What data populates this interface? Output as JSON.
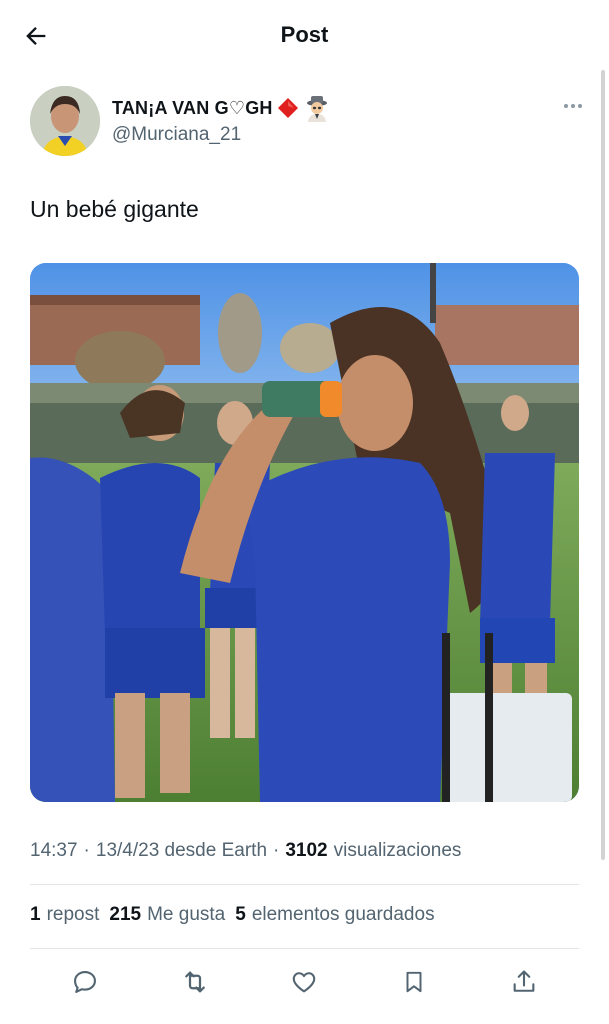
{
  "header": {
    "title": "Post",
    "back_icon": "arrow-left-icon"
  },
  "author": {
    "display_name": "TAN¡A VAN G♡GH",
    "handle": "@Murciana_21",
    "emojis": [
      "diamond-emoji",
      "spy-emoji"
    ]
  },
  "tweet": {
    "text": "Un bebé gigante"
  },
  "meta": {
    "time": "14:37",
    "sep1": "·",
    "date": "13/4/23 desde Earth",
    "sep2": "·",
    "views_count": "3102",
    "views_label": "visualizaciones"
  },
  "stats": {
    "reposts_count": "1",
    "reposts_label": "repost",
    "likes_count": "215",
    "likes_label": "Me gusta",
    "bookmarks_count": "5",
    "bookmarks_label": "elementos guardados"
  },
  "actions": [
    "reply-icon",
    "repost-icon",
    "like-icon",
    "bookmark-icon",
    "share-icon"
  ],
  "colors": {
    "text": "#0f1419",
    "secondary": "#536471",
    "diamond": "#e0201e"
  }
}
